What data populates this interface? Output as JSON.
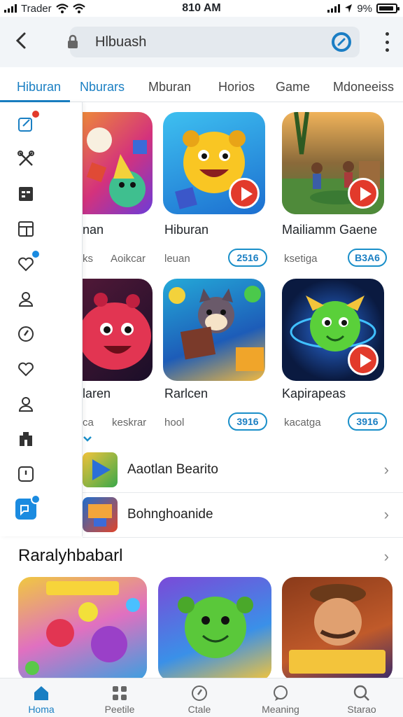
{
  "status_bar": {
    "carrier": "Trader",
    "time": "810 AM",
    "battery": "9%",
    "battery_level": 0.9
  },
  "header": {
    "back_icon": "chevron-left-icon",
    "search_value": "Hlbuash",
    "lock_icon": "lock-icon",
    "refresh_icon": "refresh-icon",
    "menu_icon": "kebab-menu-icon"
  },
  "tabs": [
    {
      "label": "Hiburan",
      "active": true
    },
    {
      "label": "Nburars",
      "active": false
    },
    {
      "label": "Mburan",
      "active": false
    },
    {
      "label": "Horios",
      "active": false
    },
    {
      "label": "Game",
      "active": false
    },
    {
      "label": "Mdoneeiss",
      "active": false
    }
  ],
  "drawer": {
    "items": [
      {
        "icon": "edit-icon",
        "badge": "red"
      },
      {
        "icon": "tools-icon"
      },
      {
        "icon": "calendar-icon"
      },
      {
        "icon": "layout-icon"
      },
      {
        "icon": "heart-badge-icon",
        "badge": "blue"
      },
      {
        "icon": "user-icon"
      },
      {
        "icon": "compass-icon"
      },
      {
        "icon": "heart-icon"
      },
      {
        "icon": "profile-icon"
      },
      {
        "icon": "building-icon"
      },
      {
        "icon": "clock-icon"
      },
      {
        "icon": "chat-icon",
        "badge": "blue"
      }
    ]
  },
  "apps": {
    "row1": [
      {
        "title": "nan",
        "meta1": "ks",
        "meta2": "Aoikcar"
      },
      {
        "title": "Hiburan",
        "meta1": "leuan",
        "pill": "2516"
      },
      {
        "title": "Mailiamm Gaene",
        "meta1": "ksetiga",
        "pill": "B3A6"
      }
    ],
    "row2": [
      {
        "title": "laren",
        "meta1": "ca",
        "meta2": "keskrar"
      },
      {
        "title": "Rarlcen",
        "meta1": "hool",
        "pill": "3916"
      },
      {
        "title": "Kapirapeas",
        "meta1": "kacatga",
        "pill": "3916"
      }
    ]
  },
  "list": [
    {
      "label": "Aaotlan Bearito",
      "icon": "arrow-game-icon"
    },
    {
      "label": "Bohnghoanide",
      "icon": "puzzle-game-icon"
    }
  ],
  "section": {
    "title": "Raralyhbabarl"
  },
  "bottom_nav": [
    {
      "label": "Homa",
      "icon": "home-icon",
      "active": true
    },
    {
      "label": "Peetile",
      "icon": "grid-icon",
      "active": false
    },
    {
      "label": "Ctale",
      "icon": "compass-icon",
      "active": false
    },
    {
      "label": "Meaning",
      "icon": "chat-bubble-icon",
      "active": false
    },
    {
      "label": "Starao",
      "icon": "search-icon",
      "active": false
    }
  ],
  "colors": {
    "accent": "#1a7fc3",
    "badge_red": "#e23a2b",
    "badge_blue": "#1b8be0"
  }
}
